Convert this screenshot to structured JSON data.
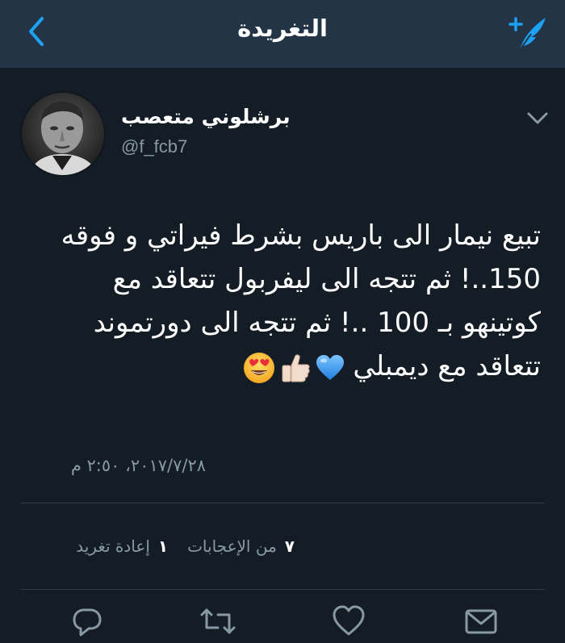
{
  "header": {
    "title": "التغريدة",
    "back_icon": "chevron-left-icon",
    "compose_icon": "compose-feather-icon",
    "accent_color": "#1da1f2"
  },
  "tweet": {
    "author_name": "برشلوني متعصب",
    "handle": "@f_fcb7",
    "avatar_icon": "avatar-photo",
    "menu_icon": "chevron-down-icon",
    "lines": [
      "تبيع نيمار الى باريس بشرط فيراتي و فوقه",
      "150..! ثم تتجه الى ليفربول تتعاقد مع",
      "كوتينهو بـ 100 ..! ثم تتجه الى دورتموند",
      "تتعاقد مع ديمبلي"
    ],
    "emojis": [
      "blue-heart",
      "thumbs-up",
      "heart-eyes"
    ],
    "timestamp": "٢٠١٧/٧/٢٨، ٢:٥٠ م"
  },
  "stats": {
    "likes_count": "٧",
    "likes_label": "من الإعجابات",
    "retweets_count": "١",
    "retweets_label": "إعادة تغريد"
  },
  "actions": {
    "reply_icon": "reply-icon",
    "retweet_icon": "retweet-icon",
    "like_icon": "heart-icon",
    "message_icon": "envelope-icon",
    "icon_color": "#8899a6"
  },
  "colors": {
    "background": "#141d26",
    "navbar": "#243447",
    "secondary_text": "#8899a6"
  }
}
